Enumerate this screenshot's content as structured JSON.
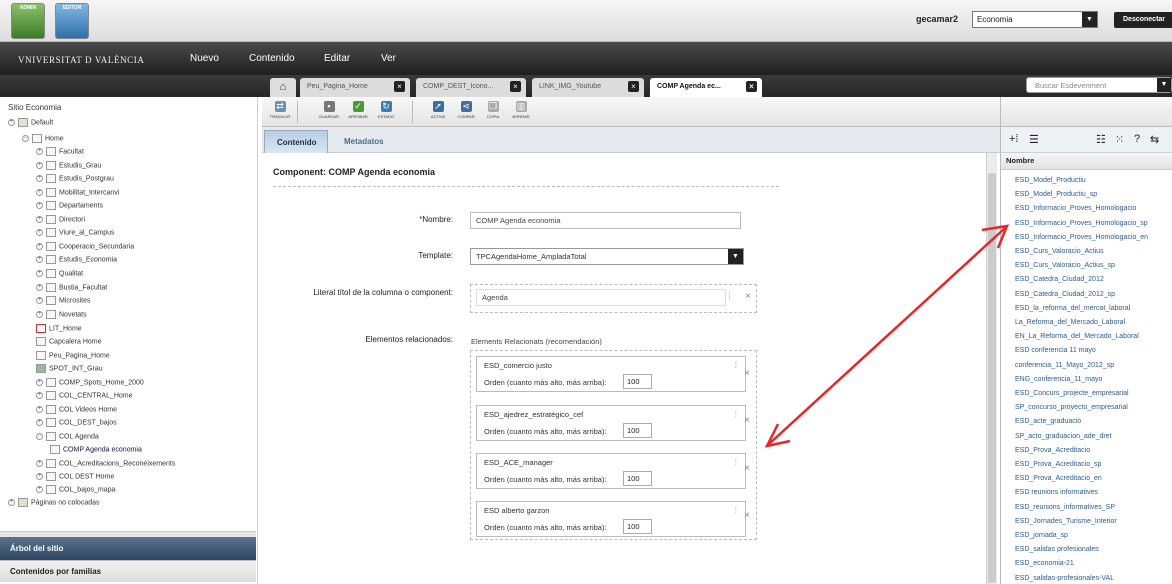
{
  "header": {
    "apps": [
      {
        "label": "ADMIN"
      },
      {
        "label": "EDITOR"
      }
    ],
    "user": "gecamar2",
    "site_select": "Economia",
    "logout": "Desconectar"
  },
  "menubar": {
    "logo": "VNIVERSITAT D VALÈNCIA",
    "items": [
      "Nuevo",
      "Contenido",
      "Editar",
      "Ver"
    ]
  },
  "tabs": [
    {
      "label": "Peu_Pagina_Home"
    },
    {
      "label": "COMP_DEST_Icono..."
    },
    {
      "label": "LINK_IMG_Youtube"
    },
    {
      "label": "COMP Agenda ec..."
    }
  ],
  "search": {
    "placeholder": "Buscar Esdevenment"
  },
  "tree": {
    "title": "Sitio Economia",
    "rows": [
      {
        "label": "Default"
      },
      {
        "label": "Home"
      },
      {
        "label": "Facultat"
      },
      {
        "label": "Estudis_Grau"
      },
      {
        "label": "Estudis_Postgrau"
      },
      {
        "label": "Mobilitat_Intercanvi"
      },
      {
        "label": "Departaments"
      },
      {
        "label": "Directori"
      },
      {
        "label": "Viure_al_Campus"
      },
      {
        "label": "Cooperacio_Secundaria"
      },
      {
        "label": "Estudis_Economia"
      },
      {
        "label": "Qualitat"
      },
      {
        "label": "Bustia_Facultat"
      },
      {
        "label": "Microsites"
      },
      {
        "label": "Novetats"
      },
      {
        "label": "LIT_Home"
      },
      {
        "label": "Capcalera Home"
      },
      {
        "label": "Peu_Pagina_Home"
      },
      {
        "label": "SPOT_INT_Grau"
      },
      {
        "label": "COMP_Spots_Home_2000"
      },
      {
        "label": "COL_CENTRAL_Home"
      },
      {
        "label": "COL Videos Home"
      },
      {
        "label": "COL_DEST_bajos"
      },
      {
        "label": "COL Agenda"
      },
      {
        "label": "COMP Agenda economia"
      },
      {
        "label": "COL_Acreditacions_Reconeixements"
      },
      {
        "label": "COL DEST Home"
      },
      {
        "label": "COL_bajos_mapa"
      },
      {
        "label": "Páginas no colocadas"
      }
    ],
    "accordion": [
      "Árbol del sitio",
      "Contenidos por familias"
    ]
  },
  "toolbar": {
    "buttons": [
      "TRADUCIR",
      "GUARDAR",
      "APROBAR",
      "ESTADO",
      "ACTIVA",
      "COMPAR",
      "COPIA",
      "BORRAR"
    ]
  },
  "content_tabs": [
    "Contenido",
    "Metadatos"
  ],
  "form": {
    "title": "Component: COMP Agenda economia",
    "nombre_label": "Nombre:",
    "nombre_value": "COMP Agenda economia",
    "template_label": "Template:",
    "template_value": "TPCAgendaHome_AmpladaTotal",
    "literal_label": "Literal títol de la columna o component:",
    "literal_value": "Agenda",
    "rel_label": "Elementos relacionados:",
    "rel_header": "Elements Relacionats    (recomendación)",
    "order_label": "Orden (cuanto más alto, más arriba):",
    "items": [
      {
        "name": "ESD_comercio justo",
        "order": "100"
      },
      {
        "name": "ESD_ajedrez_estratégico_cef",
        "order": "100"
      },
      {
        "name": "ESD_ACE_manager",
        "order": "100"
      },
      {
        "name": "ESD alberto garzon",
        "order": "100"
      }
    ]
  },
  "right_panel": {
    "header": "Nombre",
    "items": [
      "ESD_Model_Productiu",
      "ESD_Model_Productiu_sp",
      "ESD_Informacio_Proves_Homologacio",
      "ESD_Informacio_Proves_Homologacio_sp",
      "ESD_Informacio_Proves_Homologacio_en",
      "ESD_Curs_Valoracio_Actius",
      "ESD_Curs_Valoracio_Actius_sp",
      "ESD_Catedra_Ciudad_2012",
      "ESD_Catedra_Ciudad_2012_sp",
      "ESD_la_reforma_del_mercat_laboral",
      "La_Reforma_del_Mercado_Laboral",
      "EN_La_Reforma_del_Mercado_Laboral",
      "ESD conferencia 11 mayo",
      "conferencia_11_Mayo_2012_sp",
      "ENG_conferencia_11_mayo",
      "ESD_Concurs_projecte_empresarial",
      "SP_concurso_proyecto_empresarial",
      "ESD_acte_graduacio",
      "SP_acto_graduacion_ade_dret",
      "ESD_Prova_Acreditacio",
      "ESD_Prova_Acreditacio_sp",
      "ESD_Prova_Acreditacio_en",
      "ESD reunions informatives",
      "ESD_reunions_informatives_SP",
      "ESD_Jornades_Turisme_Interior",
      "ESD_jornada_sp",
      "ESD_salidas profesionales",
      "ESD_economia-21",
      "ESD_salidas-profesionales-VAL"
    ]
  },
  "colors": {
    "annotation": "#e8262a",
    "link": "#2b5b94",
    "accordion_active": "#2d4560"
  }
}
